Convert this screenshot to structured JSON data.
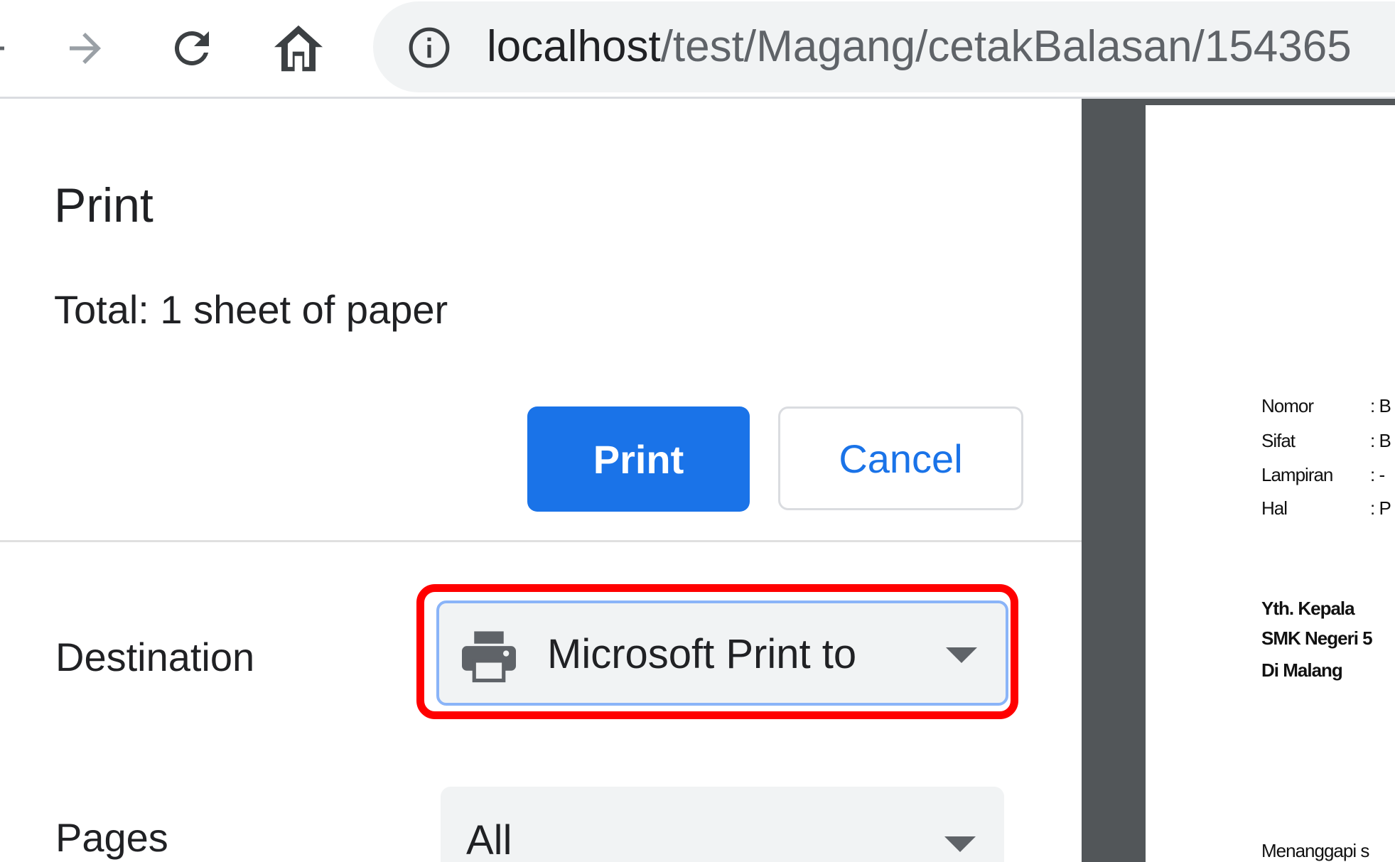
{
  "browser": {
    "url_host": "localhost",
    "url_path": "/test/Magang/cetakBalasan/154365"
  },
  "print_panel": {
    "title": "Print",
    "total": "Total: 1 sheet of paper",
    "print_label": "Print",
    "cancel_label": "Cancel",
    "destination_label": "Destination",
    "destination_value": "Microsoft Print to",
    "pages_label": "Pages",
    "pages_value": "All"
  },
  "preview": {
    "fields": [
      {
        "label": "Nomor",
        "value": ": B"
      },
      {
        "label": "Sifat",
        "value": ": B"
      },
      {
        "label": "Lampiran",
        "value": ": -"
      },
      {
        "label": "Hal",
        "value": ": P"
      }
    ],
    "address": [
      "Yth. Kepala",
      "SMK Negeri 5",
      "Di Malang"
    ],
    "body_start": "Menanggapi s"
  },
  "colors": {
    "primary": "#1a73e8",
    "highlight": "#ff0000",
    "preview_bg": "#525659"
  }
}
